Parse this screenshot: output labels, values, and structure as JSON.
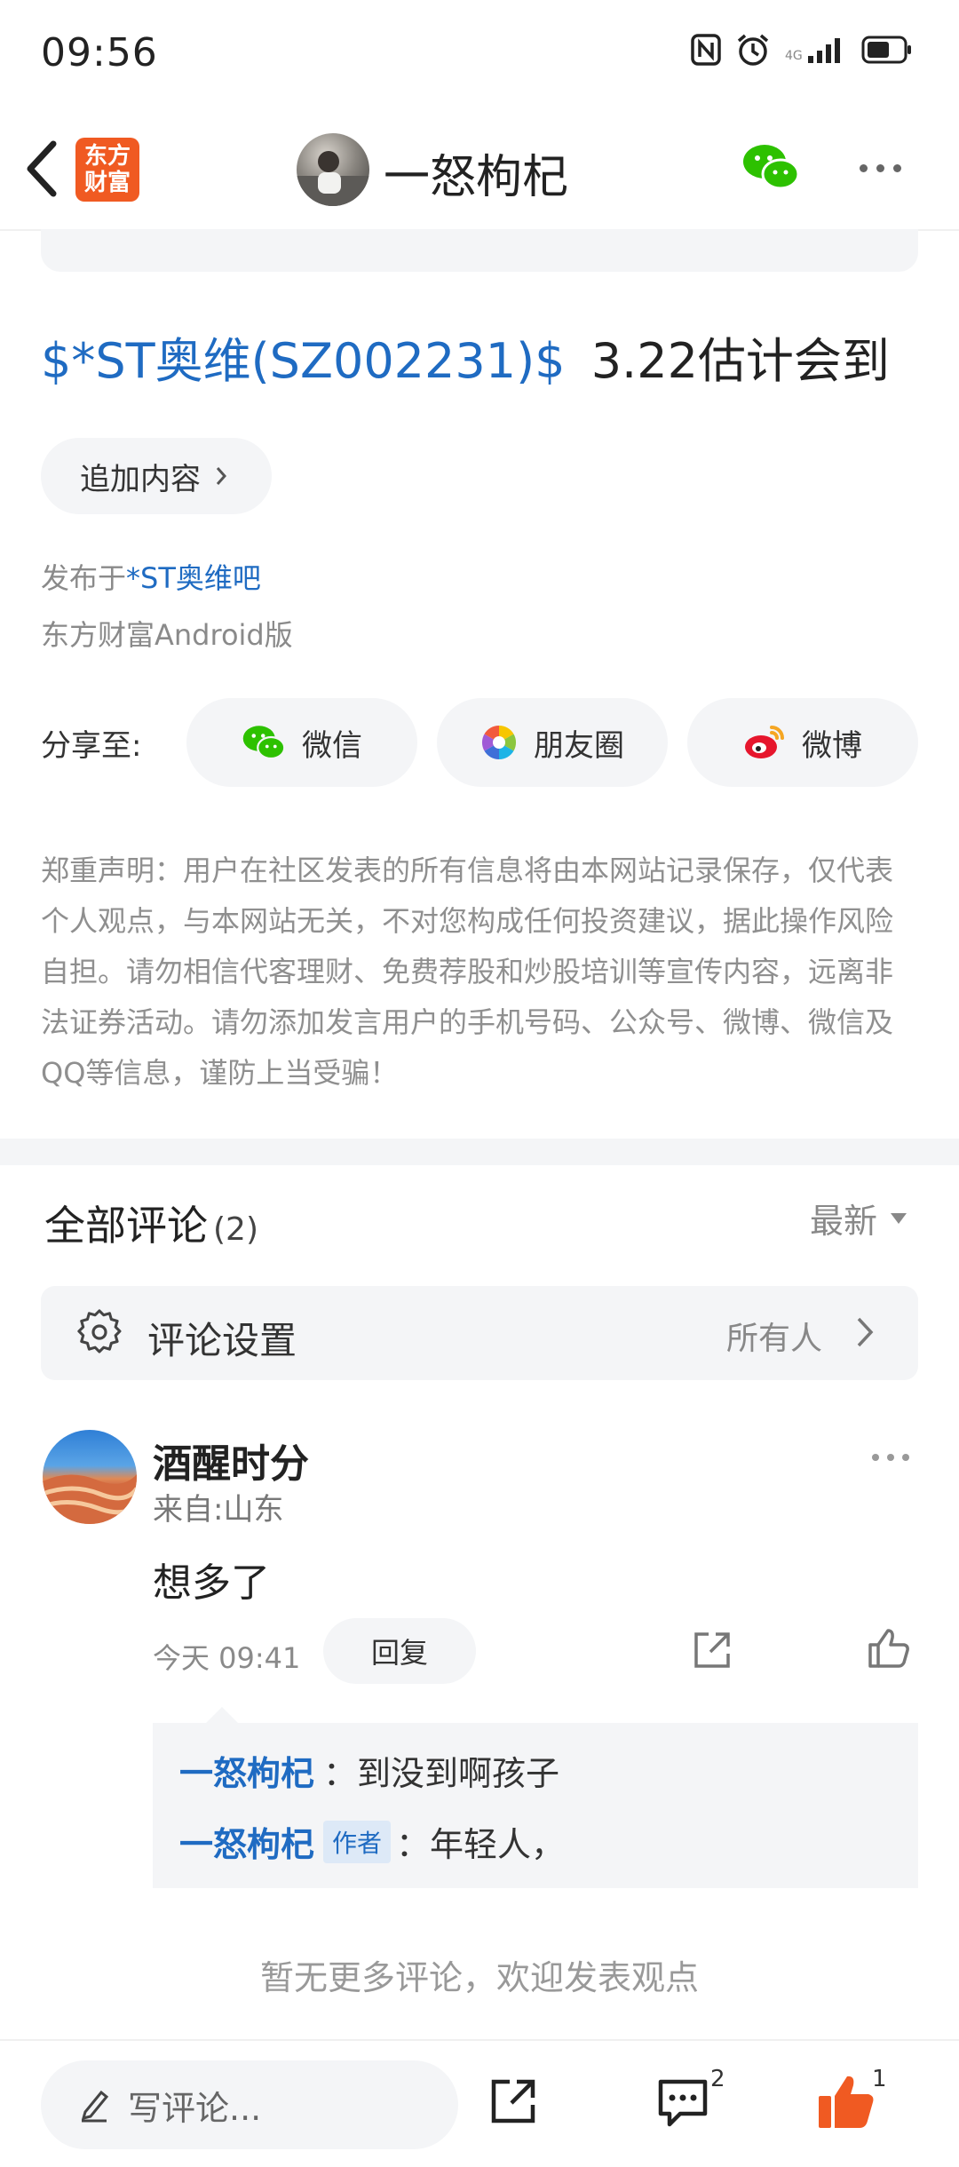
{
  "status_bar": {
    "time": "09:56"
  },
  "header": {
    "brand_logo_line1": "东方",
    "brand_logo_line2": "财富",
    "author_name": "一怒枸杞",
    "brand_color": "#f05a22"
  },
  "post": {
    "stock_tag": "$*ST奥维(SZ002231)$",
    "title_text": "3.22估计会到",
    "append_label": "追加内容",
    "published_prefix": "发布于",
    "forum_name": "*ST奥维吧",
    "client": "东方财富Android版"
  },
  "share": {
    "label": "分享至:",
    "targets": [
      {
        "label": "微信",
        "icon": "wechat-icon"
      },
      {
        "label": "朋友圈",
        "icon": "moments-icon"
      },
      {
        "label": "微博",
        "icon": "weibo-icon"
      }
    ]
  },
  "disclaimer": "郑重声明：用户在社区发表的所有信息将由本网站记录保存，仅代表个人观点，与本网站无关，不对您构成任何投资建议，据此操作风险自担。请勿相信代客理财、免费荐股和炒股培训等宣传内容，远离非法证券活动。请勿添加发言用户的手机号码、公众号、微博、微信及QQ等信息，谨防上当受骗！",
  "comments": {
    "title": "全部评论",
    "count": "(2)",
    "sort_label": "最新",
    "settings_label": "评论设置",
    "settings_value": "所有人",
    "items": [
      {
        "user": "酒醒时分",
        "from": "来自:山东",
        "text": "想多了",
        "time": "今天 09:41",
        "reply_label": "回复",
        "replies": [
          {
            "who": "一怒枸杞",
            "tag": "",
            "text": "：到没到啊孩子"
          },
          {
            "who": "一怒枸杞",
            "tag": "作者",
            "text": "：年轻人，"
          }
        ]
      }
    ],
    "no_more": "暂无更多评论，欢迎发表观点"
  },
  "bottom_bar": {
    "write_placeholder": "写评论...",
    "comment_count": "2",
    "like_count": "1",
    "like_color": "#f05a22"
  },
  "colors": {
    "link": "#1f6bc2",
    "muted": "#8a8a8a",
    "panel": "#f4f5f7"
  }
}
